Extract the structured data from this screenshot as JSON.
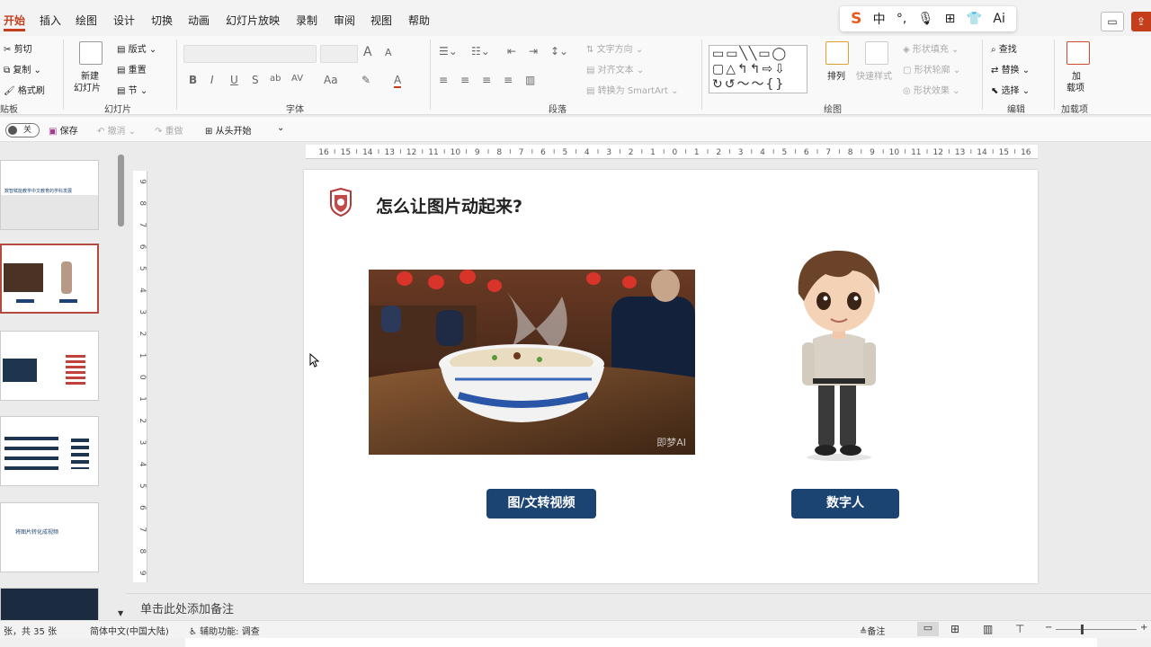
{
  "menu": {
    "tabs": [
      "开始",
      "插入",
      "绘图",
      "设计",
      "切换",
      "动画",
      "幻灯片放映",
      "录制",
      "审阅",
      "视图",
      "帮助"
    ],
    "active": "开始"
  },
  "ime": {
    "logo": "S",
    "items": [
      "中",
      "°,",
      "🎙",
      "⊞",
      "👕",
      "Ai"
    ]
  },
  "ribbon": {
    "clipboard": {
      "cut": "剪切",
      "copy": "复制",
      "painter": "格式刷",
      "label": "贴板"
    },
    "slides": {
      "new_slide": "新建",
      "new_slide2": "幻灯片",
      "layout": "版式",
      "reset": "重置",
      "section": "节",
      "label": "幻灯片"
    },
    "font": {
      "label": "字体",
      "bold": "B",
      "italic": "I",
      "underline": "U",
      "strike": "S",
      "shadow": "ab",
      "spacing": "AV",
      "case": "Aa",
      "grow": "A",
      "shrink": "A"
    },
    "paragraph": {
      "label": "段落",
      "text_direction": "文字方向",
      "align_text": "对齐文本",
      "smartart": "转换为 SmartArt"
    },
    "drawing": {
      "label": "绘图",
      "arrange": "排列",
      "quick_styles": "快速样式",
      "fill": "形状填充",
      "outline": "形状轮廓",
      "effects": "形状效果"
    },
    "editing": {
      "label": "编辑",
      "find": "查找",
      "replace": "替换",
      "select": "选择"
    },
    "addins": {
      "label": "加载项",
      "btn1": "加",
      "btn2": "载项"
    }
  },
  "qat": {
    "autosave": "关",
    "save": "保存",
    "undo": "撤消",
    "redo": "重做",
    "from_start": "从头开始"
  },
  "hruler_labels": [
    "16",
    "15",
    "14",
    "13",
    "12",
    "11",
    "10",
    "9",
    "8",
    "7",
    "6",
    "5",
    "4",
    "3",
    "2",
    "1",
    "0",
    "1",
    "2",
    "3",
    "4",
    "5",
    "6",
    "7",
    "8",
    "9",
    "10",
    "11",
    "12",
    "13",
    "14",
    "15",
    "16"
  ],
  "vruler_labels": [
    "9",
    "8",
    "7",
    "6",
    "5",
    "4",
    "3",
    "2",
    "1",
    "0",
    "1",
    "2",
    "3",
    "4",
    "5",
    "6",
    "7",
    "8",
    "9"
  ],
  "slide": {
    "title": "怎么让图片动起来?",
    "watermark": "即梦AI",
    "button_left": "图/文转视频",
    "button_right": "数字人"
  },
  "thumbnails": {
    "t1_title": "数智赋能教学中文教育的学科发展",
    "t5_title": "将图片转化成视频"
  },
  "notes": {
    "placeholder": "单击此处添加备注"
  },
  "status": {
    "slide_count": "张，共 35 张",
    "language": "简体中文(中国大陆)",
    "accessibility": "辅助功能: 调查",
    "notes_btn": "备注"
  },
  "colors": {
    "accent": "#c43e1c",
    "slide_button": "#1b4472",
    "selected_thumb": "#b44a3e"
  }
}
